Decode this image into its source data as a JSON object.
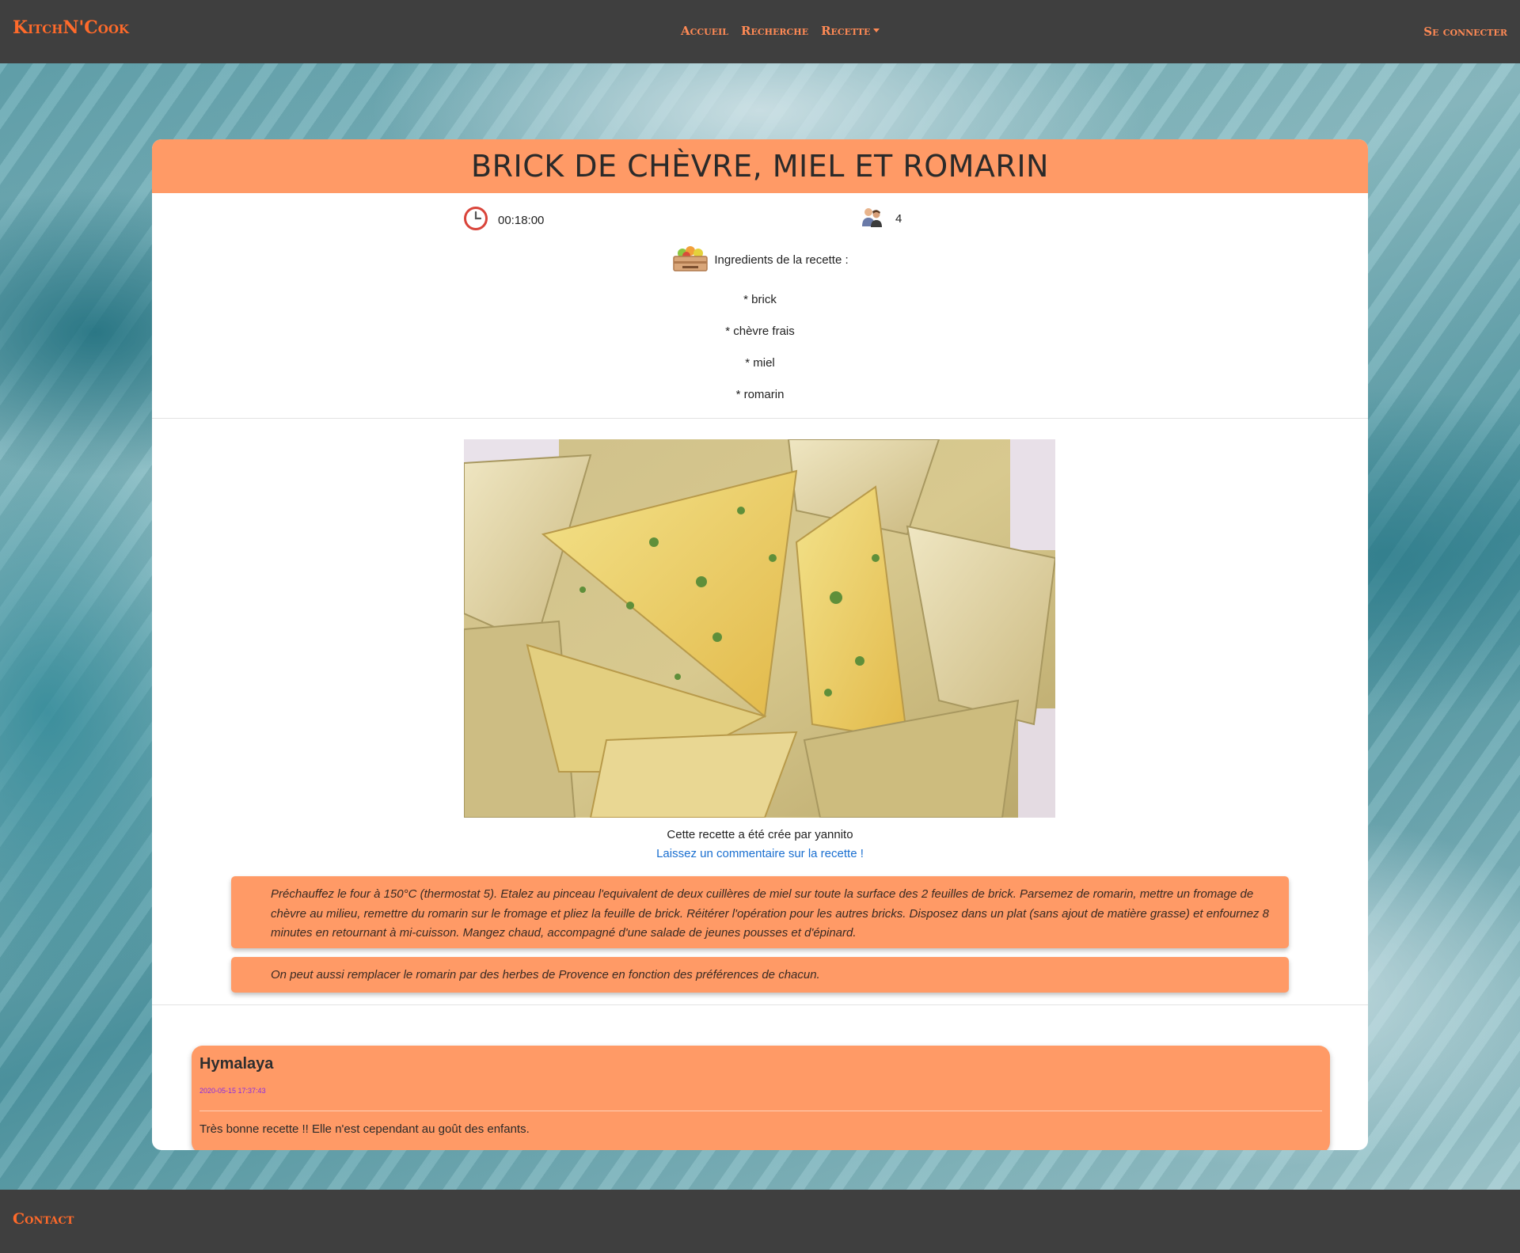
{
  "navbar": {
    "brand": "KitchN'Cook",
    "links": [
      {
        "label": "Accueil"
      },
      {
        "label": "Recherche"
      },
      {
        "label": "Recette"
      }
    ],
    "login": "Se connecter"
  },
  "recipe": {
    "title": "BRICK DE CHÈVRE, MIEL ET ROMARIN",
    "time": "00:18:00",
    "people": "4",
    "ingredients_label": "Ingredients de la recette :",
    "ingredients": [
      "* brick",
      "* chèvre frais",
      "* miel",
      "* romarin"
    ],
    "author_text": "Cette recette a été crée par yannito",
    "comment_link": "Laissez un commentaire sur la recette !",
    "steps": [
      "Préchauffez le four à 150°C (thermostat 5). Etalez au pinceau l'equivalent de deux cuillères de miel sur toute la surface des 2 feuilles de brick. Parsemez de romarin, mettre un fromage de chèvre au milieu, remettre du romarin sur le fromage et pliez la feuille de brick. Réitérer l'opération pour les autres bricks. Disposez dans un plat (sans ajout de matière grasse) et enfournez 8 minutes en retournant à mi-cuisson. Mangez chaud, accompagné d'une salade de jeunes pousses et d'épinard.",
      "On peut aussi remplacer le romarin par des herbes de Provence en fonction des préférences de chacun."
    ]
  },
  "review": {
    "user": "Hymalaya",
    "date": "2020-05-15 17:37:43",
    "text": "Très bonne recette !! Elle n'est cependant au goût des enfants."
  },
  "footer": {
    "contact": "Contact"
  },
  "colors": {
    "accent": "#ff9a66",
    "brand": "#ff6a2a",
    "nav_bg": "#3f3f3f",
    "link": "#1a6fd0"
  },
  "icons": {
    "time": "clock-icon",
    "people": "people-icon",
    "ingredients": "ingredients-crate-icon"
  }
}
